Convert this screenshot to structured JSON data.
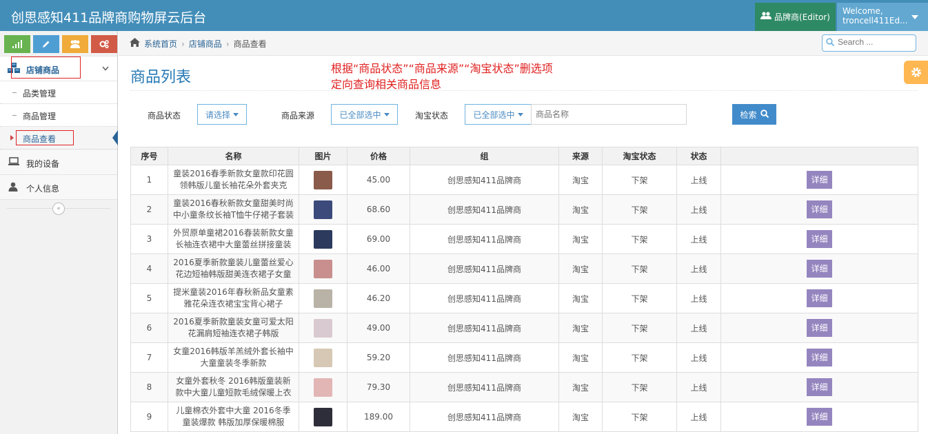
{
  "app": {
    "title": "创思感知411品牌商购物屏云后台",
    "role": "品牌商(Editor)",
    "welcome": "Welcome,",
    "username": "troncell411Ed..."
  },
  "sidebar": {
    "parent_label": "店铺商品",
    "subitems": [
      {
        "label": "品类管理"
      },
      {
        "label": "商品管理"
      },
      {
        "label": "商品查看"
      }
    ],
    "items": [
      {
        "label": "我的设备"
      },
      {
        "label": "个人信息"
      }
    ],
    "collapse_glyph": "«"
  },
  "breadcrumb": {
    "home": "系统首页",
    "section": "店铺商品",
    "current": "商品查看"
  },
  "search": {
    "placeholder": "Search ..."
  },
  "page": {
    "title": "商品列表",
    "annotation_line1": "根据“商品状态”“商品来源”“淘宝状态”删选项",
    "annotation_line2": "定向查询相关商品信息"
  },
  "filters": {
    "status_label": "商品状态",
    "status_value": "请选择",
    "source_label": "商品来源",
    "source_value": "已全部选中",
    "taobao_label": "淘宝状态",
    "taobao_value": "已全部选中",
    "name_placeholder": "商品名称",
    "search_label": "检索"
  },
  "table": {
    "headers": [
      "序号",
      "名称",
      "图片",
      "价格",
      "组",
      "来源",
      "淘宝状态",
      "状态",
      ""
    ],
    "detail_label": "详细",
    "rows": [
      {
        "no": "1",
        "name": "童装2016春季新款女童款印花圆领韩版儿童长袖花朵外套夹克",
        "price": "45.00",
        "group": "创思感知411品牌商",
        "source": "淘宝",
        "taobao": "下架",
        "status": "上线",
        "thumb_color": "#8a5a4a"
      },
      {
        "no": "2",
        "name": "童装2016春秋新款女童甜美时尚中小童条纹长袖T恤牛仔裙子套装",
        "price": "68.60",
        "group": "创思感知411品牌商",
        "source": "淘宝",
        "taobao": "下架",
        "status": "上线",
        "thumb_color": "#3b4a7a"
      },
      {
        "no": "3",
        "name": "外贸原单童裙2016春装新款女童长袖连衣裙中大童蕾丝拼接童装",
        "price": "69.00",
        "group": "创思感知411品牌商",
        "source": "淘宝",
        "taobao": "下架",
        "status": "上线",
        "thumb_color": "#2c3a5e"
      },
      {
        "no": "4",
        "name": "2016夏季新款童装儿童蕾丝爱心花边短袖韩版甜美连衣裙子女童",
        "price": "46.00",
        "group": "创思感知411品牌商",
        "source": "淘宝",
        "taobao": "下架",
        "status": "上线",
        "thumb_color": "#c98f8f"
      },
      {
        "no": "5",
        "name": "提米童装2016年春秋新品女童素雅花朵连衣裙宝宝背心裙子",
        "price": "46.20",
        "group": "创思感知411品牌商",
        "source": "淘宝",
        "taobao": "下架",
        "status": "上线",
        "thumb_color": "#b9b2a6"
      },
      {
        "no": "6",
        "name": "2016夏季新款童装女童可爱太阳花漏肩短袖连衣裙子韩版",
        "price": "49.00",
        "group": "创思感知411品牌商",
        "source": "淘宝",
        "taobao": "下架",
        "status": "上线",
        "thumb_color": "#d9c9d0"
      },
      {
        "no": "7",
        "name": "女童2016韩版羊羔绒外套长袖中大童童装冬季新款",
        "price": "59.20",
        "group": "创思感知411品牌商",
        "source": "淘宝",
        "taobao": "下架",
        "status": "上线",
        "thumb_color": "#d6c8b4"
      },
      {
        "no": "8",
        "name": "女童外套秋冬 2016韩版童装新款中大童儿童短款毛绒保暖上衣",
        "price": "79.30",
        "group": "创思感知411品牌商",
        "source": "淘宝",
        "taobao": "下架",
        "status": "上线",
        "thumb_color": "#e3b6b6"
      },
      {
        "no": "9",
        "name": "儿童棉衣外套中大童 2016冬季童装爆款 韩版加厚保暖棉服",
        "price": "189.00",
        "group": "创思感知411品牌商",
        "source": "淘宝",
        "taobao": "下架",
        "status": "上线",
        "thumb_color": "#2e2e3a"
      }
    ]
  },
  "colors": {
    "navbar": "#438eb9",
    "role_button": "#2e8965",
    "user_button": "#62a8d1",
    "detail_button": "#9585bf",
    "search_button": "#428bca",
    "annotation": "#e02020"
  },
  "icons": {
    "shortcut_1": "signal-icon",
    "shortcut_2": "pencil-icon",
    "shortcut_3": "users-icon",
    "shortcut_4": "cogs-icon",
    "settings": "gear-icon"
  }
}
